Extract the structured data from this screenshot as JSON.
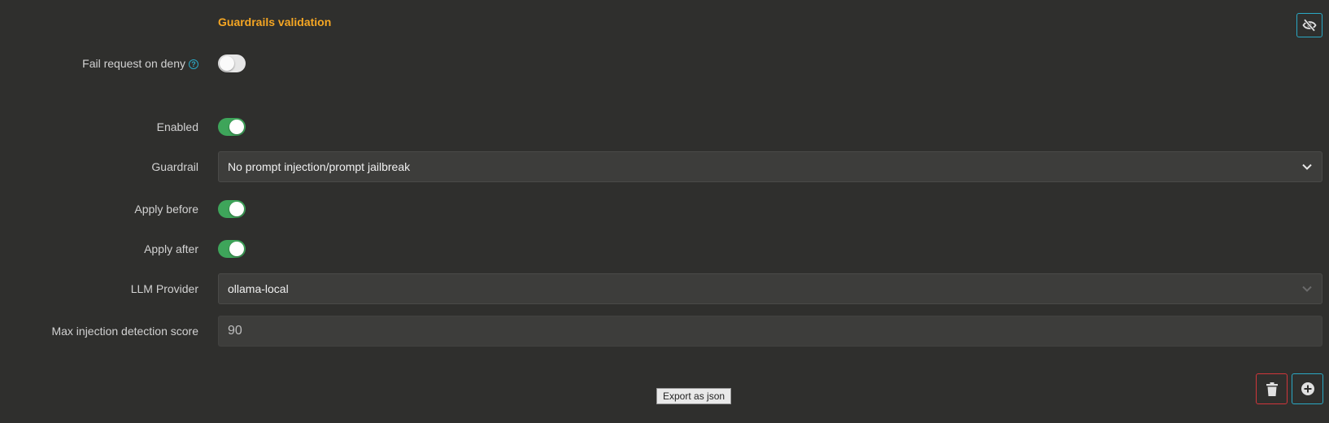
{
  "section": {
    "title": "Guardrails validation"
  },
  "fail_on_deny": {
    "label": "Fail request on deny",
    "help_icon": "question-circle-icon",
    "value": false
  },
  "enabled": {
    "label": "Enabled",
    "value": true
  },
  "guardrail": {
    "label": "Guardrail",
    "value": "No prompt injection/prompt jailbreak"
  },
  "apply_before": {
    "label": "Apply before",
    "value": true
  },
  "apply_after": {
    "label": "Apply after",
    "value": true
  },
  "llm_provider": {
    "label": "LLM Provider",
    "value": "ollama-local"
  },
  "max_score": {
    "label": "Max injection detection score",
    "value": "90"
  },
  "tooltip": {
    "text": "Export as json"
  },
  "icons": {
    "hide": "eye-slash-icon",
    "delete": "trash-icon",
    "add": "plus-circle-icon",
    "chevron": "chevron-down-icon"
  },
  "colors": {
    "accent_orange": "#f5a623",
    "toggle_on": "#3ea55a",
    "info_blue": "#2aa8c4",
    "danger_red": "#d0363b"
  }
}
